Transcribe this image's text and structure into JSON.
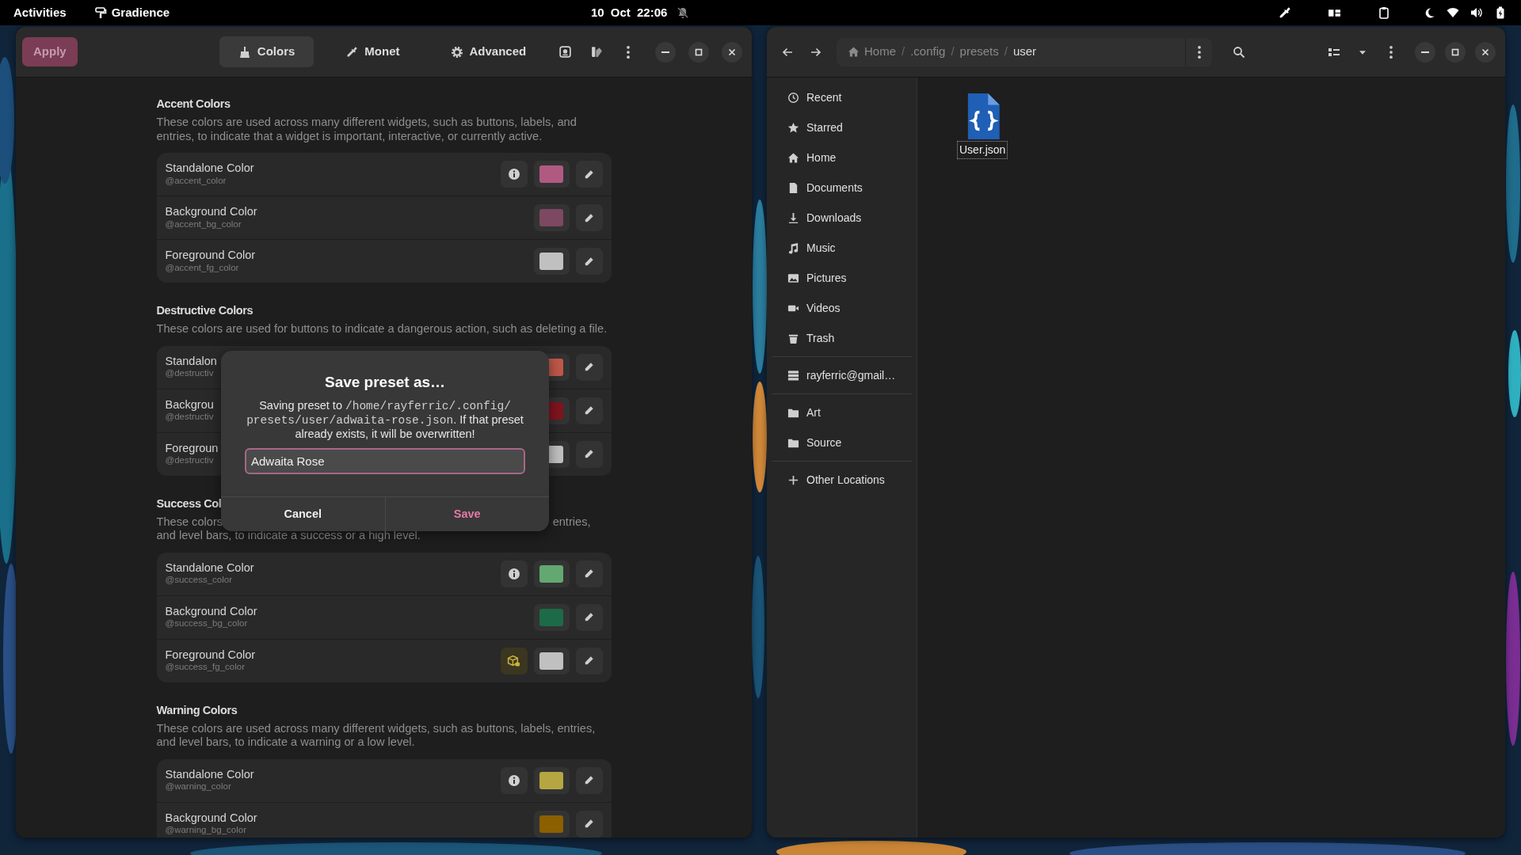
{
  "top_bar": {
    "activities": "Activities",
    "app_name": "Gradience",
    "clock": "10 Oct 22:06"
  },
  "gradience": {
    "apply": {
      "label": "Apply",
      "disabled": true
    },
    "tabs": [
      {
        "label": "Colors",
        "selected": true
      },
      {
        "label": "Monet",
        "selected": false
      },
      {
        "label": "Advanced",
        "selected": false
      }
    ],
    "sections": [
      {
        "title": "Accent Colors",
        "description": "These colors are used across many different widgets, such as buttons, labels, and entries, to indicate that a widget is important, interactive, or currently active.",
        "rows": [
          {
            "kind": "info",
            "title": "Standalone Color",
            "variable": "@accent_color",
            "color": "#b05a82"
          },
          {
            "kind": "plain",
            "title": "Background Color",
            "variable": "@accent_bg_color",
            "color": "#7c4862"
          },
          {
            "kind": "plain",
            "title": "Foreground Color",
            "variable": "@accent_fg_color",
            "color": "#c0c0c0"
          }
        ]
      },
      {
        "title": "Destructive Colors",
        "description": "These colors are used for buttons to indicate a dangerous action, such as deleting a file.",
        "rows": [
          {
            "kind": "plain",
            "title": "Standalon",
            "variable": "@destructiv",
            "color": "#c0584a"
          },
          {
            "kind": "plain",
            "title": "Backgrou",
            "variable": "@destructiv",
            "color": "#80141e"
          },
          {
            "kind": "plain",
            "title": "Foregroun",
            "variable": "@destructiv",
            "color": "#c0c0c0"
          }
        ]
      },
      {
        "title": "Success Col",
        "description_parts": [
          {
            "kind": "start",
            "text": "These colors"
          },
          {
            "kind": "end",
            "text": "entries,"
          },
          {
            "kind": "start",
            "text": "and level bars, to indicate a success or a high level."
          }
        ],
        "rows": [
          {
            "kind": "info",
            "title": "Standalone Color",
            "variable": "@success_color",
            "color": "#62a870"
          },
          {
            "kind": "plain",
            "title": "Background Color",
            "variable": "@success_bg_color",
            "color": "#1d6b46"
          },
          {
            "kind": "package",
            "title": "Foreground Color",
            "variable": "@success_fg_color",
            "color": "#c0c0c0"
          }
        ]
      },
      {
        "title": "Warning Colors",
        "description": "These colors are used across many different widgets, such as buttons, labels, entries, and level bars, to indicate a warning or a low level.",
        "rows": [
          {
            "kind": "info",
            "title": "Standalone Color",
            "variable": "@warning_color",
            "color": "#b5a642"
          },
          {
            "kind": "plain",
            "title": "Background Color",
            "variable": "@warning_bg_color",
            "color": "#8c5f00"
          }
        ]
      }
    ]
  },
  "dialog": {
    "title": "Save preset as…",
    "message": [
      {
        "kind": "text",
        "text": "Saving preset to "
      },
      {
        "kind": "code",
        "text": "/home/rayferric/.config/presets/user/adwaita-rose.json"
      },
      {
        "kind": "text",
        "text": ". If that preset already exists, it will be overwritten!"
      }
    ],
    "entry": {
      "value": "Adwaita Rose",
      "focused": true
    },
    "buttons": [
      {
        "label": "Cancel",
        "kind": "default"
      },
      {
        "label": "Save",
        "kind": "suggested"
      }
    ]
  },
  "files": {
    "path_bar": [
      {
        "kind": "crumb",
        "label": "Home",
        "selected": false
      },
      {
        "kind": "separator",
        "label": "/"
      },
      {
        "kind": "crumb",
        "label": ".config",
        "selected": false
      },
      {
        "kind": "separator",
        "label": "/"
      },
      {
        "kind": "crumb",
        "label": "presets",
        "selected": false
      },
      {
        "kind": "separator",
        "label": "/"
      },
      {
        "kind": "crumb",
        "label": "user",
        "selected": true
      }
    ],
    "sidebar": [
      {
        "items": [
          {
            "label": "Recent",
            "selected": false
          },
          {
            "label": "Starred",
            "selected": false
          },
          {
            "label": "Home",
            "selected": false
          },
          {
            "label": "Documents",
            "selected": false
          },
          {
            "label": "Downloads",
            "selected": false
          },
          {
            "label": "Music",
            "selected": false
          },
          {
            "label": "Pictures",
            "selected": false
          },
          {
            "label": "Videos",
            "selected": false
          },
          {
            "label": "Trash",
            "selected": false
          }
        ]
      },
      {
        "items": [
          {
            "label": "rayferric@gmail…",
            "selected": false
          }
        ]
      },
      {
        "items": [
          {
            "label": "Art",
            "selected": false
          },
          {
            "label": "Source",
            "selected": false
          }
        ]
      },
      {
        "items": [
          {
            "label": "Other Locations",
            "selected": false
          }
        ]
      }
    ],
    "items": [
      {
        "name": "User.json",
        "focused": true
      }
    ]
  }
}
